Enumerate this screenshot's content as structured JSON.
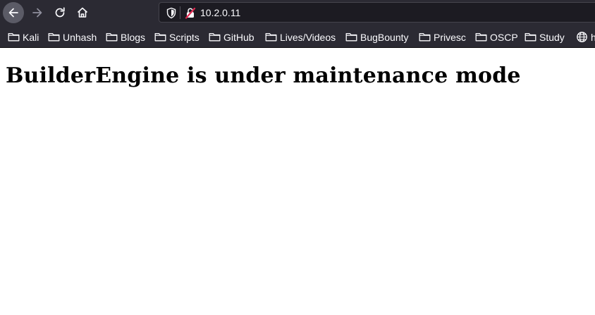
{
  "browser": {
    "url": "10.2.0.11",
    "bookmarks": [
      {
        "label": "Kali",
        "icon": "folder-icon"
      },
      {
        "label": "Unhash",
        "icon": "folder-icon"
      },
      {
        "label": "Blogs",
        "icon": "folder-icon"
      },
      {
        "label": "Scripts",
        "icon": "folder-icon"
      },
      {
        "label": "GitHub",
        "icon": "folder-icon"
      },
      {
        "label": "Lives/Videos",
        "icon": "folder-icon"
      },
      {
        "label": "BugBounty",
        "icon": "folder-icon"
      },
      {
        "label": "Privesc",
        "icon": "folder-icon"
      },
      {
        "label": "OSCP",
        "icon": "folder-icon"
      },
      {
        "label": "Study",
        "icon": "folder-icon"
      },
      {
        "label": "h",
        "icon": "globe-icon"
      }
    ],
    "colors": {
      "chrome_bg": "#2b2a33",
      "urlbar_bg": "#1c1b22",
      "text": "#fbfbfe",
      "insecure_lock": "#e22850"
    }
  },
  "page": {
    "heading": "BuilderEngine is under maintenance mode"
  }
}
